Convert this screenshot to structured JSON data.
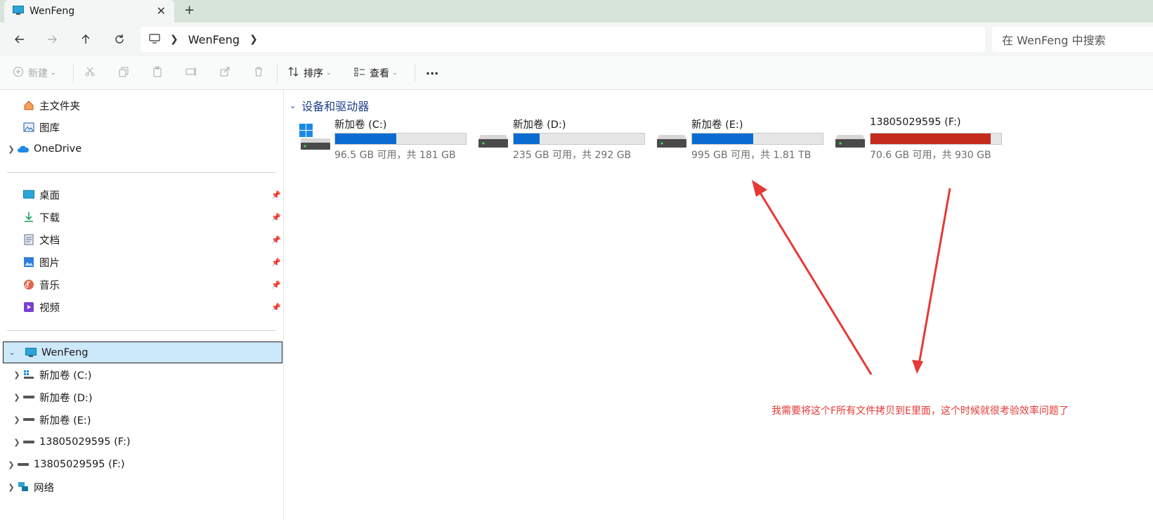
{
  "window": {
    "tab_title": "WenFeng",
    "tab_close": "✕",
    "new_tab": "+"
  },
  "address": {
    "breadcrumb": [
      "WenFeng"
    ],
    "search_placeholder": "在 WenFeng 中搜索"
  },
  "toolbar": {
    "new_label": "新建",
    "sort_label": "排序",
    "view_label": "查看",
    "more_label": "···"
  },
  "sidebar": {
    "quick": [
      {
        "label": "主文件夹",
        "icon": "home-icon"
      },
      {
        "label": "图库",
        "icon": "gallery-icon"
      },
      {
        "label": "OneDrive",
        "icon": "cloud-icon"
      }
    ],
    "pinned": [
      {
        "label": "桌面",
        "icon": "desktop-icon"
      },
      {
        "label": "下载",
        "icon": "download-icon"
      },
      {
        "label": "文档",
        "icon": "document-icon"
      },
      {
        "label": "图片",
        "icon": "pictures-icon"
      },
      {
        "label": "音乐",
        "icon": "music-icon"
      },
      {
        "label": "视频",
        "icon": "video-icon"
      }
    ],
    "this_pc": "WenFeng",
    "drives": [
      {
        "label": "新加卷 (C:)"
      },
      {
        "label": "新加卷 (D:)"
      },
      {
        "label": "新加卷 (E:)"
      },
      {
        "label": "13805029595 (F:)"
      }
    ],
    "external": "13805029595 (F:)",
    "network": "网络"
  },
  "content": {
    "section_title": "设备和驱动器",
    "drives": [
      {
        "name": "新加卷 (C:)",
        "info": "96.5 GB 可用，共 181 GB",
        "used_fraction": 0.47,
        "icon": "windows-drive-icon",
        "full": false
      },
      {
        "name": "新加卷 (D:)",
        "info": "235 GB 可用，共 292 GB",
        "used_fraction": 0.2,
        "icon": "drive-icon",
        "full": false
      },
      {
        "name": "新加卷 (E:)",
        "info": "995 GB 可用，共 1.81 TB",
        "used_fraction": 0.47,
        "icon": "drive-icon",
        "full": false
      },
      {
        "name": "13805029595 (F:)",
        "info": "70.6 GB 可用，共 930 GB",
        "used_fraction": 0.92,
        "icon": "drive-icon",
        "full": true
      }
    ]
  },
  "annotation": {
    "text": "我需要将这个F所有文件拷贝到E里面，这个时候就很考验效率问题了",
    "color": "#e53935"
  },
  "colors": {
    "accent": "#0a6bd1",
    "full_bar": "#c42b1c",
    "selection": "#cce8fb"
  }
}
